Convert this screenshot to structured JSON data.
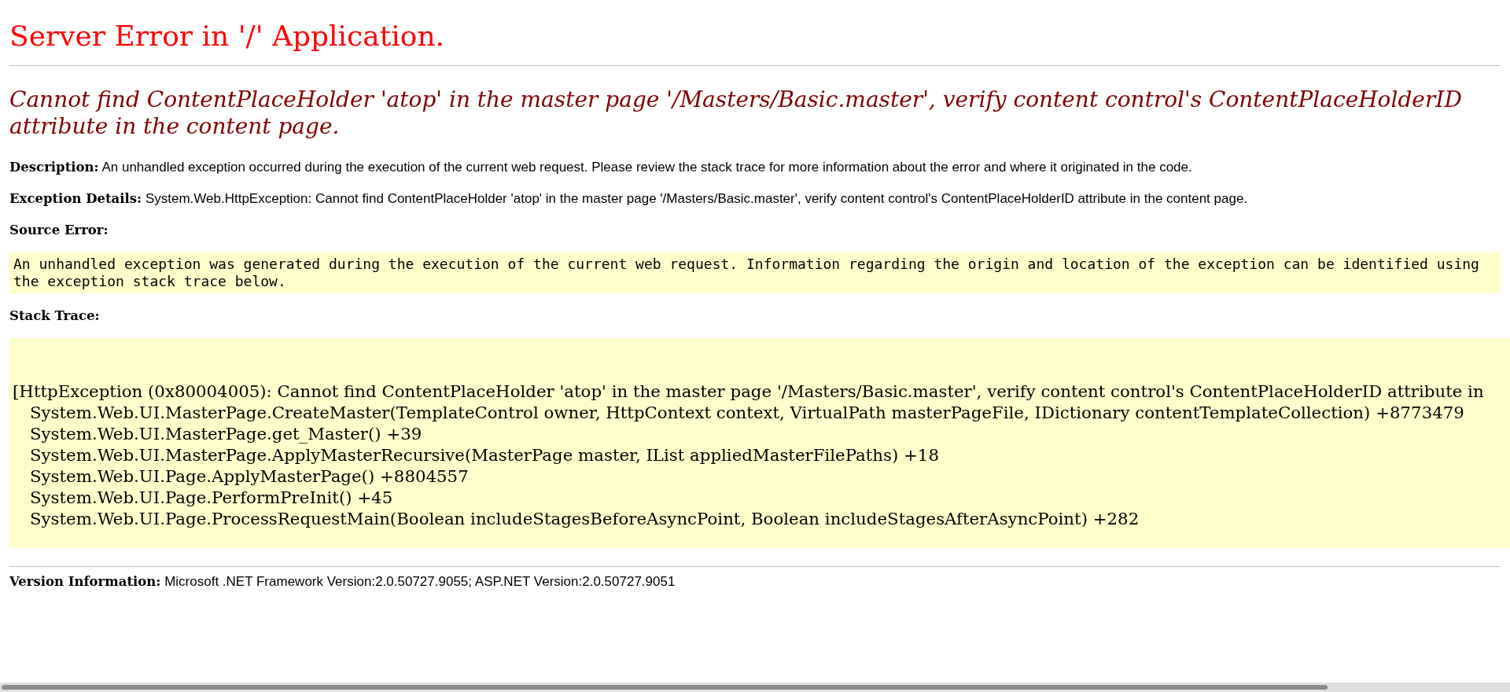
{
  "title": "Server Error in '/' Application.",
  "error_message": "Cannot find ContentPlaceHolder 'atop' in the master page '/Masters/Basic.master', verify content control's ContentPlaceHolderID attribute in the content page.",
  "description": {
    "label": "Description:",
    "text": "An unhandled exception occurred during the execution of the current web request. Please review the stack trace for more information about the error and where it originated in the code."
  },
  "exception_details": {
    "label": "Exception Details:",
    "text": "System.Web.HttpException: Cannot find ContentPlaceHolder 'atop' in the master page '/Masters/Basic.master', verify content control's ContentPlaceHolderID attribute in the content page."
  },
  "source_error": {
    "label": "Source Error:",
    "text": "An unhandled exception was generated during the execution of the current web request. Information regarding the origin and location of the exception can be identified using the exception stack trace below."
  },
  "stack_trace": {
    "label": "Stack Trace:",
    "lines": [
      {
        "kind": "exception",
        "text": "[HttpException (0x80004005): Cannot find ContentPlaceHolder 'atop' in the master page '/Masters/Basic.master', verify content control's ContentPlaceHolderID attribute in"
      },
      {
        "kind": "frame",
        "text": "System.Web.UI.MasterPage.CreateMaster(TemplateControl owner, HttpContext context, VirtualPath masterPageFile, IDictionary contentTemplateCollection) +8773479"
      },
      {
        "kind": "frame",
        "text": "System.Web.UI.MasterPage.get_Master() +39"
      },
      {
        "kind": "frame",
        "text": "System.Web.UI.MasterPage.ApplyMasterRecursive(MasterPage master, IList appliedMasterFilePaths) +18"
      },
      {
        "kind": "frame",
        "text": "System.Web.UI.Page.ApplyMasterPage() +8804557"
      },
      {
        "kind": "frame",
        "text": "System.Web.UI.Page.PerformPreInit() +45"
      },
      {
        "kind": "frame",
        "text": "System.Web.UI.Page.ProcessRequestMain(Boolean includeStagesBeforeAsyncPoint, Boolean includeStagesAfterAsyncPoint) +282"
      }
    ]
  },
  "version_information": {
    "label": "Version Information:",
    "text": "Microsoft .NET Framework Version:2.0.50727.9055; ASP.NET Version:2.0.50727.9051"
  }
}
